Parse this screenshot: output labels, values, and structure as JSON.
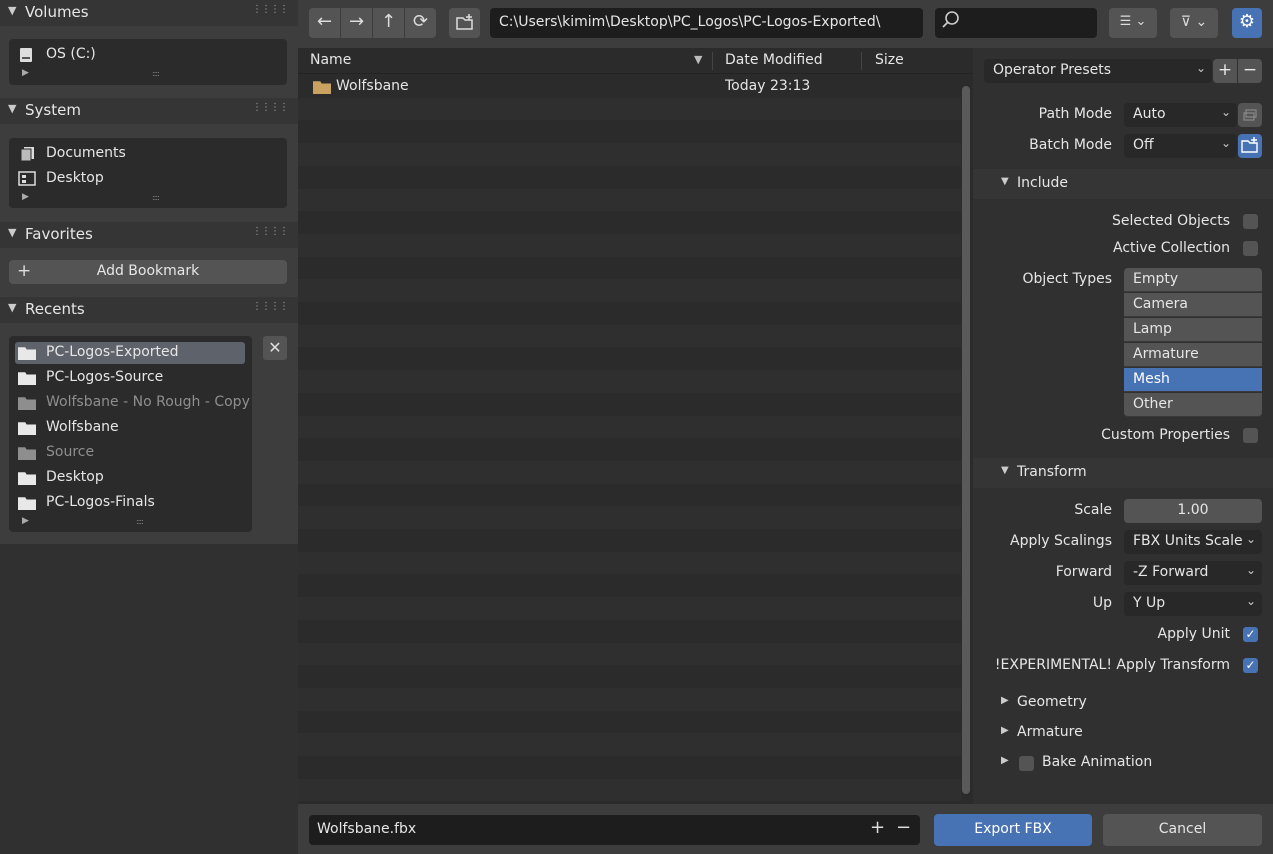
{
  "sidebar": {
    "volumes": {
      "title": "Volumes",
      "items": [
        {
          "label": "OS (C:)",
          "icon": "drive-icon"
        }
      ]
    },
    "system": {
      "title": "System",
      "items": [
        {
          "label": "Documents",
          "icon": "documents-icon"
        },
        {
          "label": "Desktop",
          "icon": "desktop-icon"
        }
      ]
    },
    "favorites": {
      "title": "Favorites",
      "add_bookmark": "Add Bookmark"
    },
    "recents": {
      "title": "Recents",
      "items": [
        {
          "label": "PC-Logos-Exported"
        },
        {
          "label": "PC-Logos-Source"
        },
        {
          "label": "Wolfsbane - No Rough - Copy"
        },
        {
          "label": "Wolfsbane"
        },
        {
          "label": "Source"
        },
        {
          "label": "Desktop"
        },
        {
          "label": "PC-Logos-Finals"
        }
      ]
    }
  },
  "toolbar": {
    "path": "C:\\Users\\kimim\\Desktop\\PC_Logos\\PC-Logos-Exported\\",
    "search_placeholder": ""
  },
  "file_list": {
    "columns": {
      "name": "Name",
      "date": "Date Modified",
      "size": "Size"
    },
    "rows": [
      {
        "name": "Wolfsbane",
        "date": "Today 23:13",
        "size": ""
      }
    ]
  },
  "options": {
    "operator_presets": "Operator Presets",
    "path_mode": {
      "label": "Path Mode",
      "value": "Auto"
    },
    "batch_mode": {
      "label": "Batch Mode",
      "value": "Off"
    },
    "include": {
      "title": "Include",
      "selected_objects": "Selected Objects",
      "active_collection": "Active Collection",
      "object_types_label": "Object Types",
      "object_types": [
        "Empty",
        "Camera",
        "Lamp",
        "Armature",
        "Mesh",
        "Other"
      ],
      "custom_properties": "Custom Properties"
    },
    "transform": {
      "title": "Transform",
      "scale_label": "Scale",
      "scale_value": "1.00",
      "apply_scalings_label": "Apply Scalings",
      "apply_scalings_value": "FBX Units Scale",
      "forward_label": "Forward",
      "forward_value": "-Z Forward",
      "up_label": "Up",
      "up_value": "Y Up",
      "apply_unit": "Apply Unit",
      "apply_transform": "!EXPERIMENTAL! Apply Transform"
    },
    "geometry": "Geometry",
    "armature": "Armature",
    "bake_animation": "Bake Animation"
  },
  "footer": {
    "filename": "Wolfsbane.fbx",
    "export_label": "Export FBX",
    "cancel_label": "Cancel"
  },
  "colors": {
    "accent": "#4772b3",
    "panel": "#303030",
    "list_bg": "#2b2b2b"
  }
}
